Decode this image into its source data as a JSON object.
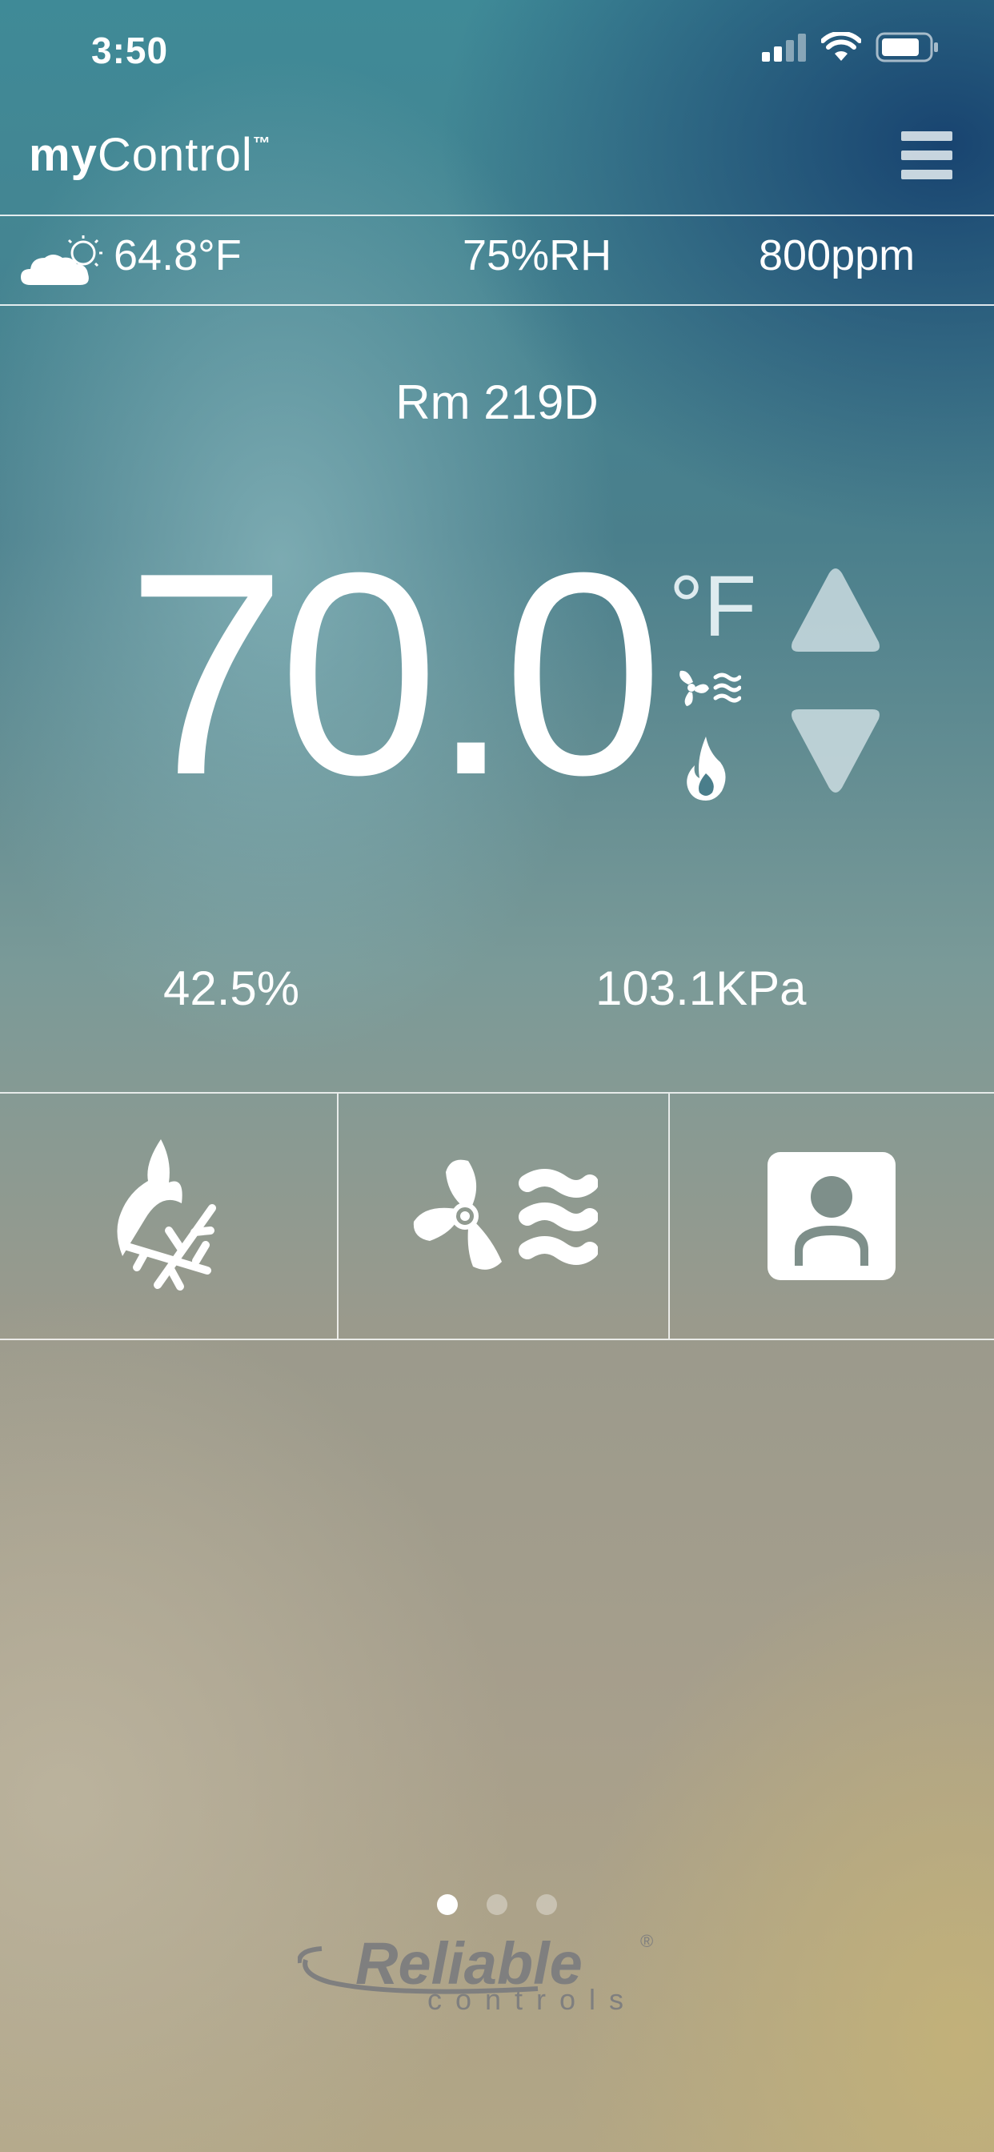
{
  "status_bar": {
    "time": "3:50"
  },
  "header": {
    "brand_bold": "my",
    "brand_rest": "Control",
    "brand_tm": "™"
  },
  "outdoor": {
    "temperature": "64.8°F",
    "humidity": "75%RH",
    "co2": "800ppm"
  },
  "room": {
    "name": "Rm 219D",
    "setpoint": "70.0",
    "unit": "°F",
    "humidity": "42.5%",
    "pressure": "103.1KPa"
  },
  "pager": {
    "total": 3,
    "active": 1
  },
  "logo": {
    "word": "Reliable",
    "sub": "controls",
    "reg": "®"
  },
  "colors": {
    "text": "#ffffff",
    "logo": "#7f7f7f",
    "accent_top": "#16406e"
  }
}
